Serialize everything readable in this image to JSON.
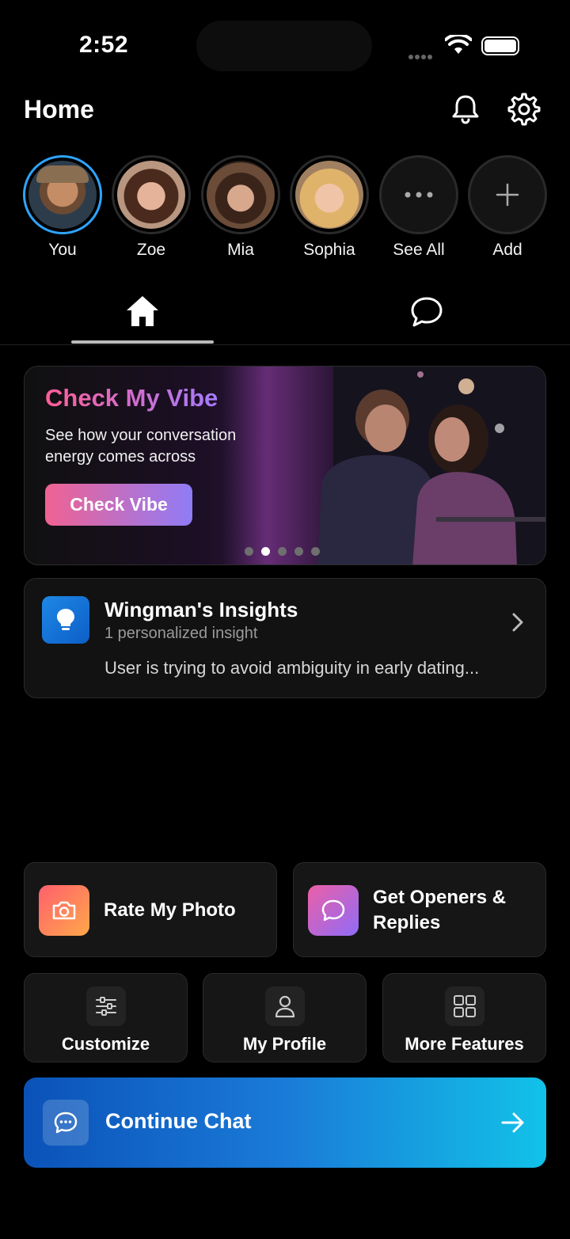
{
  "status_bar": {
    "time": "2:52"
  },
  "header": {
    "title": "Home"
  },
  "stories": [
    {
      "name": "You"
    },
    {
      "name": "Zoe"
    },
    {
      "name": "Mia"
    },
    {
      "name": "Sophia"
    },
    {
      "name": "See All"
    },
    {
      "name": "Add"
    }
  ],
  "vibe_banner": {
    "title": "Check My Vibe",
    "subtitle": "See how your conversation energy comes across",
    "button_label": "Check Vibe",
    "page_count": 5,
    "active_page": 1
  },
  "insights": {
    "title": "Wingman's Insights",
    "count_text": "1 personalized insight",
    "preview": "User is trying to avoid ambiguity in early dating..."
  },
  "features": {
    "rate_photo": "Rate My Photo",
    "openers_line1": "Get Openers &",
    "openers_line2": "Replies",
    "customize": "Customize",
    "my_profile": "My Profile",
    "more_features": "More Features"
  },
  "continue": {
    "label": "Continue Chat"
  },
  "colors": {
    "accent_blue": "#2ea4ff",
    "vibe_gradient_start": "#ff5e97",
    "vibe_gradient_end": "#a57bff",
    "rate_gradient_start": "#ff5f6d",
    "rate_gradient_end": "#ffa84a",
    "openers_gradient_start": "#ec5fa6",
    "openers_gradient_end": "#8f6cf8",
    "continue_gradient_start": "#0b52b8",
    "continue_gradient_end": "#12c2e8"
  },
  "icons": {
    "notifications": "bell-icon",
    "settings": "gear-icon",
    "home_tab": "home-icon",
    "chat_tab": "chat-bubble-icon",
    "insight": "lightbulb-icon",
    "chevron": "chevron-right-icon",
    "rate_photo": "camera-icon",
    "openers": "chat-bubbles-icon",
    "customize": "sliders-icon",
    "profile": "person-icon",
    "more": "grid-icon",
    "continue": "chat-dots-icon",
    "arrow": "arrow-right-icon"
  }
}
